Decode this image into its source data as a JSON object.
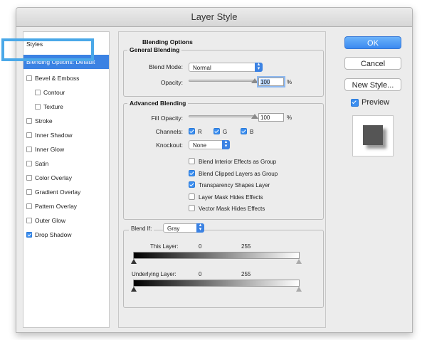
{
  "window": {
    "title": "Layer Style"
  },
  "sidebar": {
    "items": [
      {
        "label": "Styles",
        "checkbox": null,
        "selected": false,
        "indent": 0
      },
      {
        "label": "Blending Options: Default",
        "checkbox": null,
        "selected": true,
        "indent": 0
      },
      {
        "label": "Bevel & Emboss",
        "checkbox": false,
        "selected": false,
        "indent": 0
      },
      {
        "label": "Contour",
        "checkbox": false,
        "selected": false,
        "indent": 1
      },
      {
        "label": "Texture",
        "checkbox": false,
        "selected": false,
        "indent": 1
      },
      {
        "label": "Stroke",
        "checkbox": false,
        "selected": false,
        "indent": 0
      },
      {
        "label": "Inner Shadow",
        "checkbox": false,
        "selected": false,
        "indent": 0
      },
      {
        "label": "Inner Glow",
        "checkbox": false,
        "selected": false,
        "indent": 0
      },
      {
        "label": "Satin",
        "checkbox": false,
        "selected": false,
        "indent": 0
      },
      {
        "label": "Color Overlay",
        "checkbox": false,
        "selected": false,
        "indent": 0
      },
      {
        "label": "Gradient Overlay",
        "checkbox": false,
        "selected": false,
        "indent": 0
      },
      {
        "label": "Pattern Overlay",
        "checkbox": false,
        "selected": false,
        "indent": 0
      },
      {
        "label": "Outer Glow",
        "checkbox": false,
        "selected": false,
        "indent": 0
      },
      {
        "label": "Drop Shadow",
        "checkbox": true,
        "selected": false,
        "indent": 0
      }
    ]
  },
  "blending": {
    "section_title": "Blending Options",
    "general": {
      "title": "General Blending",
      "blend_mode_label": "Blend Mode:",
      "blend_mode_value": "Normal",
      "opacity_label": "Opacity:",
      "opacity_value": "100",
      "opacity_unit": "%"
    },
    "advanced": {
      "title": "Advanced Blending",
      "fill_opacity_label": "Fill Opacity:",
      "fill_opacity_value": "100",
      "fill_opacity_unit": "%",
      "channels_label": "Channels:",
      "channels": [
        {
          "label": "R",
          "checked": true
        },
        {
          "label": "G",
          "checked": true
        },
        {
          "label": "B",
          "checked": true
        }
      ],
      "knockout_label": "Knockout:",
      "knockout_value": "None",
      "options": [
        {
          "label": "Blend Interior Effects as Group",
          "checked": false
        },
        {
          "label": "Blend Clipped Layers as Group",
          "checked": true
        },
        {
          "label": "Transparency Shapes Layer",
          "checked": true
        },
        {
          "label": "Layer Mask Hides Effects",
          "checked": false
        },
        {
          "label": "Vector Mask Hides Effects",
          "checked": false
        }
      ]
    },
    "blend_if": {
      "label": "Blend If:",
      "value": "Gray",
      "this_layer_label": "This Layer:",
      "this_layer_low": "0",
      "this_layer_high": "255",
      "underlying_label": "Underlying Layer:",
      "underlying_low": "0",
      "underlying_high": "255"
    }
  },
  "buttons": {
    "ok": "OK",
    "cancel": "Cancel",
    "new_style": "New Style...",
    "preview_label": "Preview",
    "preview_checked": true
  },
  "colors": {
    "accent": "#3b82e3",
    "highlight_box": "#4aa8e8"
  }
}
